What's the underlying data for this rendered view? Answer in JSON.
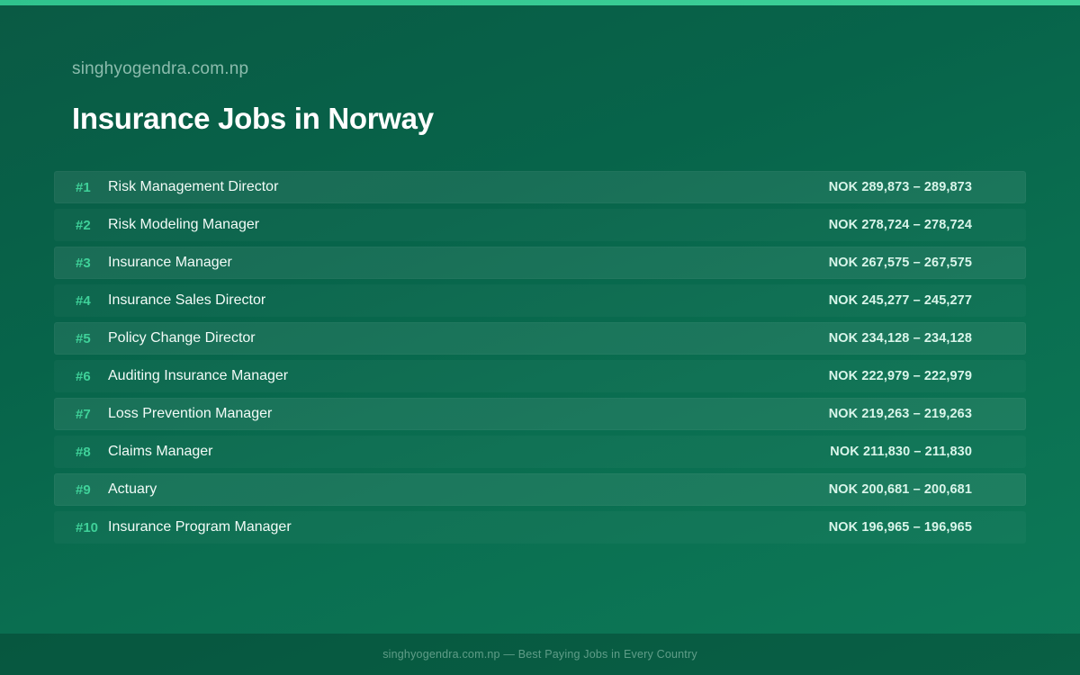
{
  "header": {
    "site_name": "singhyogendra.com.np",
    "title": "Insurance Jobs in Norway"
  },
  "jobs": [
    {
      "rank": "#1",
      "title": "Risk Management Director",
      "salary": "NOK 289,873 – 289,873"
    },
    {
      "rank": "#2",
      "title": "Risk Modeling Manager",
      "salary": "NOK 278,724 – 278,724"
    },
    {
      "rank": "#3",
      "title": "Insurance Manager",
      "salary": "NOK 267,575 – 267,575"
    },
    {
      "rank": "#4",
      "title": "Insurance Sales Director",
      "salary": "NOK 245,277 – 245,277"
    },
    {
      "rank": "#5",
      "title": "Policy Change Director",
      "salary": "NOK 234,128 – 234,128"
    },
    {
      "rank": "#6",
      "title": "Auditing Insurance Manager",
      "salary": "NOK 222,979 – 222,979"
    },
    {
      "rank": "#7",
      "title": "Loss Prevention Manager",
      "salary": "NOK 219,263 – 219,263"
    },
    {
      "rank": "#8",
      "title": "Claims Manager",
      "salary": "NOK 211,830 – 211,830"
    },
    {
      "rank": "#9",
      "title": "Actuary",
      "salary": "NOK 200,681 – 200,681"
    },
    {
      "rank": "#10",
      "title": "Insurance Program Manager",
      "salary": "NOK 196,965 – 196,965"
    }
  ],
  "footer": {
    "text": "singhyogendra.com.np — Best Paying Jobs in Every Country"
  },
  "colors": {
    "accent": "#3fd199",
    "top_bar": "#2fc38d",
    "background": "#07644a"
  }
}
